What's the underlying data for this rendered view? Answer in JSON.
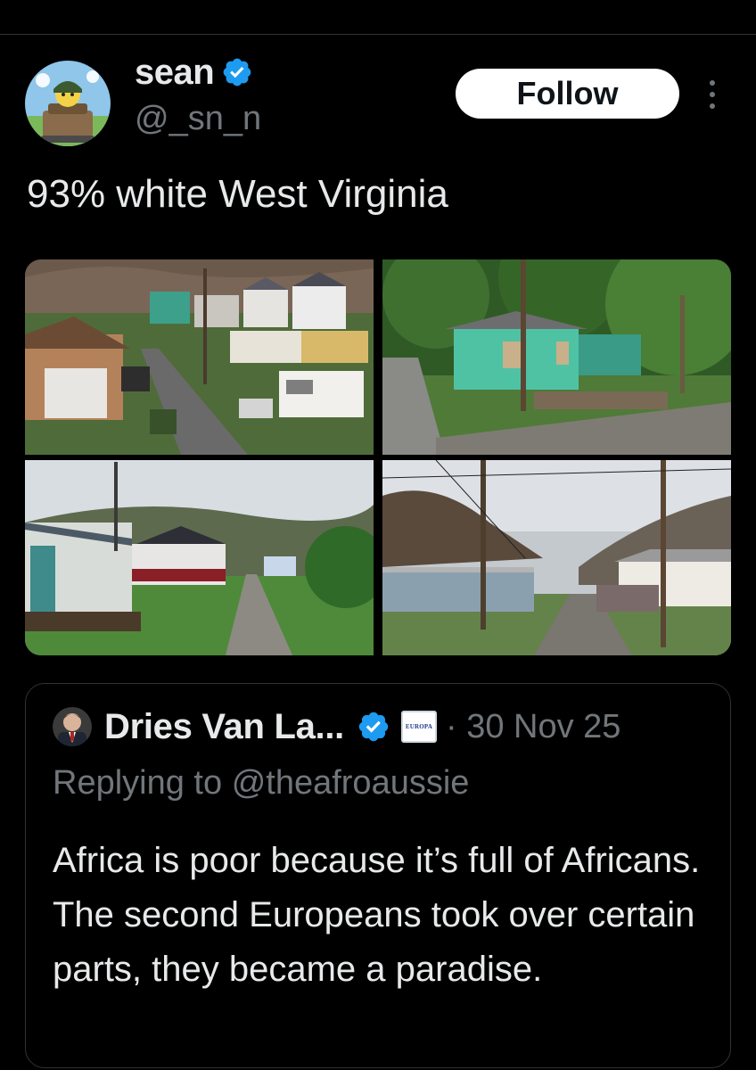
{
  "post": {
    "author": {
      "display_name": "sean",
      "handle": "@_sn_n"
    },
    "follow_label": "Follow",
    "text": "93% white West Virginia"
  },
  "quoted_post": {
    "author": {
      "display_name": "Dries Van La...",
      "badge_text": "EUROPA"
    },
    "date_separator": "·",
    "date": "30 Nov 25",
    "replying_prefix": "Replying to",
    "replying_to": "@theafroaussie",
    "body": "Africa is poor because it’s full of Africans. The second Europeans took over certain parts, they became a paradise."
  },
  "icons": {
    "verified": "verified-checkmark-icon",
    "more": "more-options-icon",
    "organization_badge": "organization-badge-icon"
  },
  "colors": {
    "background": "#000000",
    "verified_blue": "#1d9bf0",
    "secondary_text": "#71767b",
    "primary_text": "#e7e9ea",
    "follow_bg": "#ffffff",
    "border": "#2f3336"
  }
}
